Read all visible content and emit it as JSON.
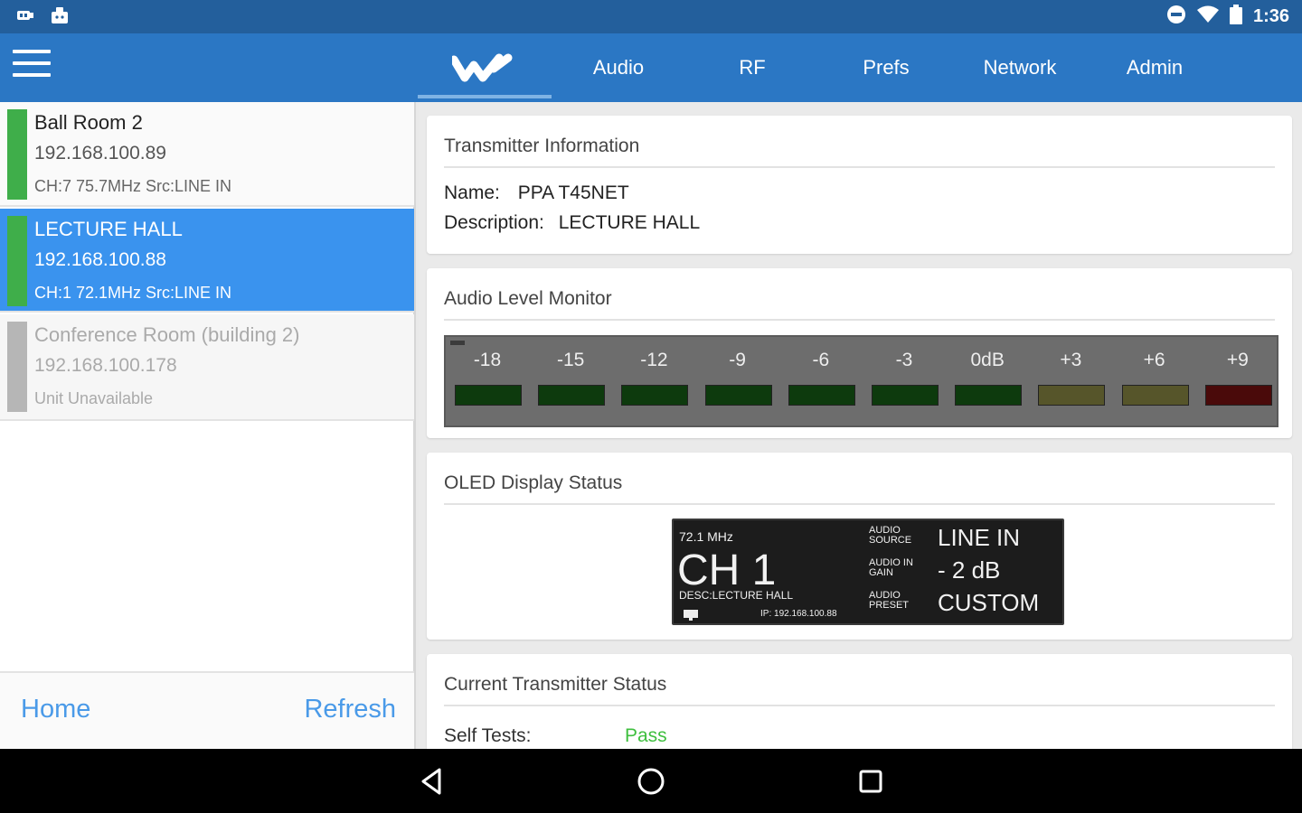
{
  "status_bar": {
    "time": "1:36",
    "left_icons": [
      "usb-debug-icon",
      "android-debug-icon"
    ],
    "right_icons": [
      "do-not-disturb-icon",
      "wifi-icon",
      "battery-icon"
    ]
  },
  "app_bar": {
    "tabs": [
      {
        "label": "Audio"
      },
      {
        "label": "RF"
      },
      {
        "label": "Prefs"
      },
      {
        "label": "Network"
      },
      {
        "label": "Admin"
      }
    ]
  },
  "sidebar": {
    "devices": [
      {
        "name": "Ball Room 2",
        "ip": "192.168.100.89",
        "info": "CH:7  75.7MHz  Src:LINE IN",
        "status_color": "#3fae4a"
      },
      {
        "name": "LECTURE HALL",
        "ip": "192.168.100.88",
        "info": "CH:1  72.1MHz  Src:LINE IN",
        "status_color": "#3fae4a"
      },
      {
        "name": "Conference Room (building 2)",
        "ip": "192.168.100.178",
        "info": "Unit Unavailable",
        "status_color": "#b6b6b6"
      }
    ],
    "home_label": "Home",
    "refresh_label": "Refresh"
  },
  "transmitter_info": {
    "title": "Transmitter Information",
    "name_label": "Name:",
    "name_value": "PPA T45NET",
    "description_label": "Description:",
    "description_value": "LECTURE HALL"
  },
  "audio_level": {
    "title": "Audio Level Monitor",
    "segments": [
      {
        "label": "-18",
        "color": "#0d3a0d"
      },
      {
        "label": "-15",
        "color": "#0d3a0d"
      },
      {
        "label": "-12",
        "color": "#0d3a0d"
      },
      {
        "label": "-9",
        "color": "#0d3a0d"
      },
      {
        "label": "-6",
        "color": "#0d3a0d"
      },
      {
        "label": "-3",
        "color": "#0d3a0d"
      },
      {
        "label": "0dB",
        "color": "#0d3a0d"
      },
      {
        "label": "+3",
        "color": "#56552a"
      },
      {
        "label": "+6",
        "color": "#56552a"
      },
      {
        "label": "+9",
        "color": "#4a0a0a"
      }
    ]
  },
  "oled": {
    "title": "OLED Display Status",
    "freq": "72.1 MHz",
    "channel": "CH 1",
    "desc": "DESC:LECTURE HALL",
    "ip": "IP: 192.168.100.88",
    "audio_source_label": "AUDIO SOURCE",
    "audio_source_value": "LINE IN",
    "audio_gain_label": "AUDIO IN GAIN",
    "audio_gain_value": "- 2 dB",
    "audio_preset_label": "AUDIO PRESET",
    "audio_preset_value": "CUSTOM"
  },
  "current_status": {
    "title": "Current Transmitter Status",
    "self_tests_label": "Self Tests:",
    "self_tests_value": "Pass",
    "pass_color": "#3fbf3f"
  },
  "colors": {
    "status_bar": "#235f9c",
    "app_bar": "#2b77c4",
    "selected_row": "#3a93ee",
    "link": "#4a9ae8"
  }
}
